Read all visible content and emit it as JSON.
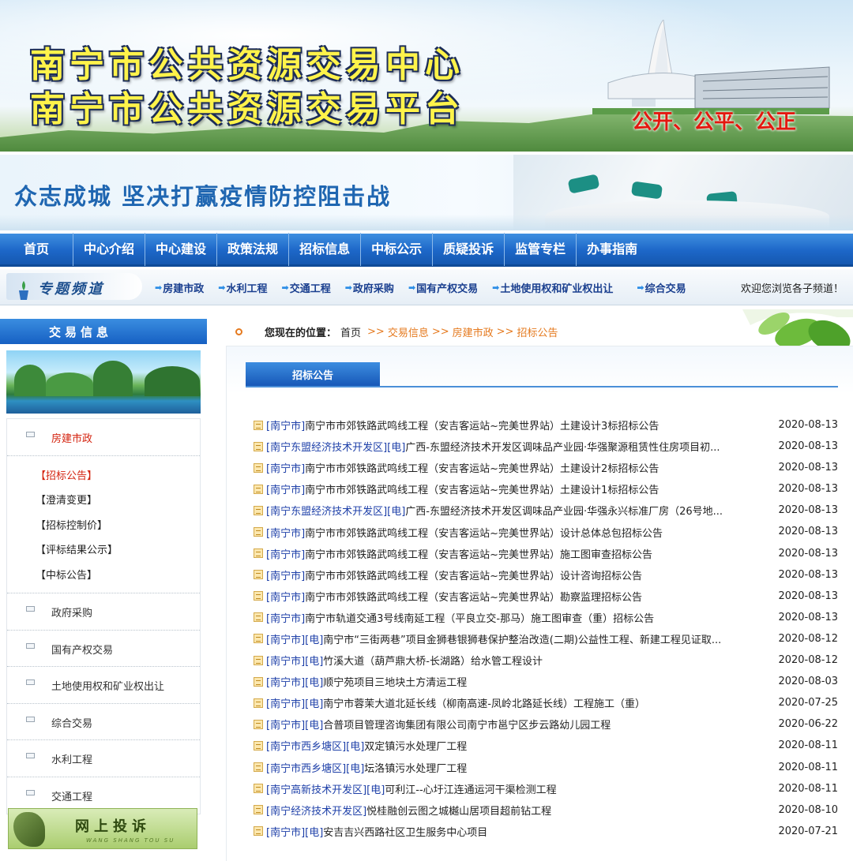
{
  "header": {
    "title_line1": "南宁市公共资源交易中心",
    "title_line2": "南宁市公共资源交易平台",
    "slogan": "公开、公平、公正"
  },
  "banner2": {
    "slogan": "众志成城   坚决打赢疫情防控阻击战"
  },
  "nav": {
    "items": [
      "首页",
      "中心介绍",
      "中心建设",
      "政策法规",
      "招标信息",
      "中标公示",
      "质疑投诉",
      "监管专栏",
      "办事指南"
    ]
  },
  "topics": {
    "label": "专题频道",
    "links": [
      "房建市政",
      "水利工程",
      "交通工程",
      "政府采购",
      "国有产权交易",
      "土地使用权和矿业权出让",
      "综合交易"
    ],
    "welcome": "欢迎您浏览各子频道！"
  },
  "sidebar": {
    "header": "交易信息",
    "menu_active": "房建市政",
    "subitems": [
      "【招标公告】",
      "【澄清变更】",
      "【招标控制价】",
      "【评标结果公示】",
      "【中标公告】"
    ],
    "menu_others": [
      "政府采购",
      "国有产权交易",
      "土地使用权和矿业权出让",
      "综合交易",
      "水利工程",
      "交通工程"
    ],
    "complaint_title": "网上投诉",
    "complaint_sub": "WANG SHANG TOU SU"
  },
  "breadcrumb": {
    "label": "您现在的位置：",
    "home": "首页",
    "sep": ">>",
    "seg1": "交易信息",
    "seg2": "房建市政",
    "seg3": "招标公告"
  },
  "panel": {
    "tab": "招标公告"
  },
  "list": [
    {
      "tag": "[南宁市]",
      "title": "南宁市市郊铁路武鸣线工程（安吉客运站~完美世界站）土建设计3标招标公告",
      "date": "2020-08-13"
    },
    {
      "tag": "[南宁东盟经济技术开发区][电]",
      "title": "广西-东盟经济技术开发区调味品产业园·华强聚源租赁性住房项目初...",
      "date": "2020-08-13"
    },
    {
      "tag": "[南宁市]",
      "title": "南宁市市郊铁路武鸣线工程（安吉客运站~完美世界站）土建设计2标招标公告",
      "date": "2020-08-13"
    },
    {
      "tag": "[南宁市]",
      "title": "南宁市市郊铁路武鸣线工程（安吉客运站~完美世界站）土建设计1标招标公告",
      "date": "2020-08-13"
    },
    {
      "tag": "[南宁东盟经济技术开发区][电]",
      "title": "广西-东盟经济技术开发区调味品产业园·华强永兴标准厂房（26号地...",
      "date": "2020-08-13"
    },
    {
      "tag": "[南宁市]",
      "title": "南宁市市郊铁路武鸣线工程（安吉客运站~完美世界站）设计总体总包招标公告",
      "date": "2020-08-13"
    },
    {
      "tag": "[南宁市]",
      "title": "南宁市市郊铁路武鸣线工程（安吉客运站~完美世界站）施工图审查招标公告",
      "date": "2020-08-13"
    },
    {
      "tag": "[南宁市]",
      "title": "南宁市市郊铁路武鸣线工程（安吉客运站~完美世界站）设计咨询招标公告",
      "date": "2020-08-13"
    },
    {
      "tag": "[南宁市]",
      "title": "南宁市市郊铁路武鸣线工程（安吉客运站~完美世界站）勘察监理招标公告",
      "date": "2020-08-13"
    },
    {
      "tag": "[南宁市]",
      "title": "南宁市轨道交通3号线南延工程（平良立交-那马）施工图审查（重）招标公告",
      "date": "2020-08-13"
    },
    {
      "tag": "[南宁市][电]",
      "title": "南宁市“三街两巷”项目金狮巷银狮巷保护整治改造(二期)公益性工程、新建工程见证取...",
      "date": "2020-08-12"
    },
    {
      "tag": "[南宁市][电]",
      "title": "竹溪大道（葫芦鼎大桥-长湖路）给水管工程设计",
      "date": "2020-08-12"
    },
    {
      "tag": "[南宁市][电]",
      "title": "顺宁苑项目三地块土方清运工程",
      "date": "2020-08-03"
    },
    {
      "tag": "[南宁市][电]",
      "title": "南宁市蓉茉大道北延长线（柳南高速-凤岭北路延长线）工程施工（重）",
      "date": "2020-07-25"
    },
    {
      "tag": "[南宁市][电]",
      "title": "合普项目管理咨询集团有限公司南宁市邕宁区步云路幼儿园工程",
      "date": "2020-06-22"
    },
    {
      "tag": "[南宁市西乡塘区][电]",
      "title": "双定镇污水处理厂工程",
      "date": "2020-08-11"
    },
    {
      "tag": "[南宁市西乡塘区][电]",
      "title": "坛洛镇污水处理厂工程",
      "date": "2020-08-11"
    },
    {
      "tag": "[南宁高新技术开发区][电]",
      "title": "可利江--心圩江连通运河干渠检测工程",
      "date": "2020-08-11"
    },
    {
      "tag": "[南宁经济技术开发区]",
      "title": "悦桂融创云图之城樾山居项目超前钻工程",
      "date": "2020-08-10"
    },
    {
      "tag": "[南宁市][电]",
      "title": "安吉吉兴西路社区卫生服务中心项目",
      "date": "2020-07-21"
    }
  ]
}
